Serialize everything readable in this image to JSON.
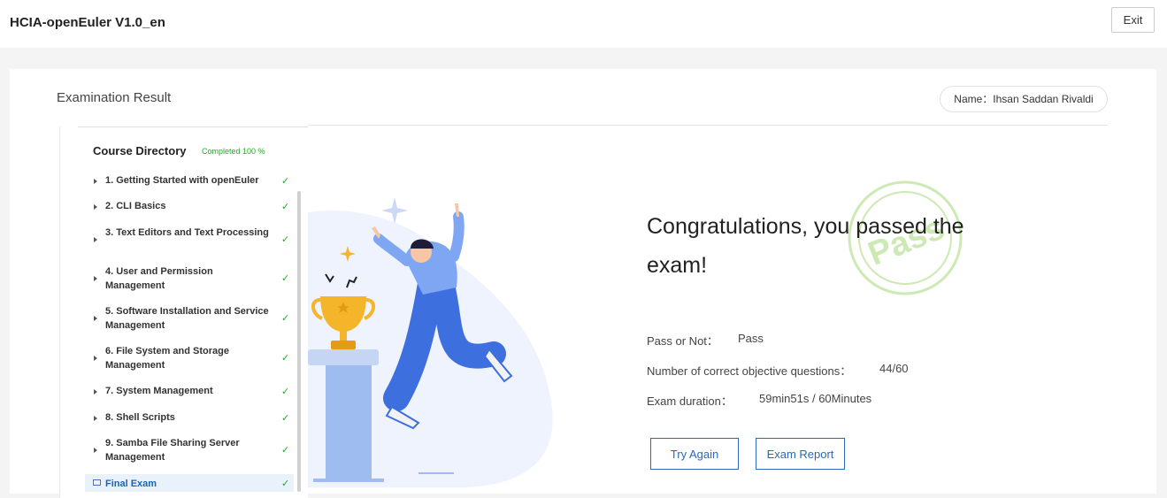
{
  "app": {
    "title": "HCIA-openEuler V1.0_en",
    "exit_label": "Exit"
  },
  "page": {
    "title": "Examination Result",
    "name_label": "Name：Ihsan Saddan Rivaldi"
  },
  "directory": {
    "title": "Course Directory",
    "completed": "Completed 100 %",
    "items": [
      {
        "label": "1. Getting Started with openEuler"
      },
      {
        "label": "2. CLI Basics"
      },
      {
        "label": "3. Text Editors and Text Processing"
      },
      {
        "label": "4. User and Permission Management"
      },
      {
        "label": "5. Software Installation and Service Management"
      },
      {
        "label": "6. File System and Storage Management"
      },
      {
        "label": "7. System Management"
      },
      {
        "label": "8. Shell Scripts"
      },
      {
        "label": "9. Samba File Sharing Server Management"
      },
      {
        "label": "Final Exam"
      }
    ],
    "check_glyph": "✓"
  },
  "result": {
    "headline": "Congratulations, you passed the exam!",
    "stamp_text": "Pass",
    "pass_label": "Pass or Not：",
    "pass_value": "Pass",
    "correct_label": "Number of correct objective questions：",
    "correct_value": "44/60",
    "duration_label": "Exam duration：",
    "duration_value": "59min51s / 60Minutes"
  },
  "actions": {
    "try_again": "Try Again",
    "exam_report": "Exam Report"
  },
  "colors": {
    "accent": "#2b68b5",
    "success": "#2aa52a",
    "stamp": "#cde9b4",
    "illustration": "#4f86e8"
  }
}
